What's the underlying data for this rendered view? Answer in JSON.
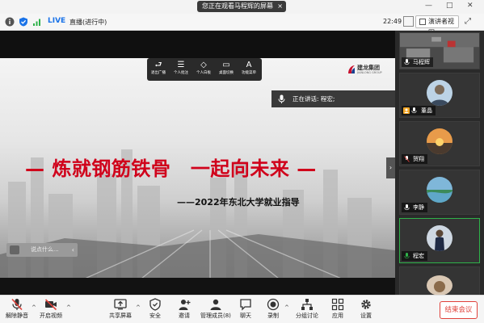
{
  "title_bar": {
    "sharing_notice": "您正在观看马程辉的屏幕",
    "close_glyph": "×",
    "minimize_glyph": "—",
    "maximize_glyph": "□",
    "close_window_glyph": "✕"
  },
  "info_bar": {
    "live_label": "LIVE",
    "live_status": "直播(进行中)",
    "clock": "22:49",
    "view_mode_label": "演讲者视图",
    "fullscreen_glyph": "⤢"
  },
  "slide": {
    "tools": [
      {
        "icon": "exit-icon",
        "glyph": "⮐",
        "label": "退出广播"
      },
      {
        "icon": "notes-icon",
        "glyph": "☰",
        "label": "个人批注"
      },
      {
        "icon": "whiteboard-icon",
        "glyph": "◇",
        "label": "个人白板"
      },
      {
        "icon": "desktop-share-icon",
        "glyph": "▭",
        "label": "桌面切换"
      },
      {
        "icon": "tools-menu-icon",
        "glyph": "A",
        "label": "功能菜单"
      }
    ],
    "brand_name": "建龙集团",
    "brand_sub": "JIANLONG GROUP",
    "speaking_label": "正在讲话: 程宏;",
    "headline": "— 炼就钢筋铁骨　一起向未来 —",
    "subline": "——2022年东北大学就业指导",
    "chat_placeholder": "说点什么...",
    "chat_toggle": "‹",
    "collapse_glyph": "›",
    "colors": {
      "headline": "#d0021b",
      "speaker_bar": "#3a3a3a"
    }
  },
  "participants": [
    {
      "name": "马程辉",
      "avatar": "video-feed",
      "active": false,
      "mic_icon": "mic-on-icon"
    },
    {
      "name": "董晶",
      "avatar": "photo",
      "active": false,
      "mic_icon": "mic-on-icon",
      "host_badge": "host-icon"
    },
    {
      "name": "贺翔",
      "avatar": "sunset-photo",
      "active": false,
      "mic_icon": "mic-muted-icon"
    },
    {
      "name": "李静",
      "avatar": "lake-photo",
      "active": false,
      "mic_icon": "mic-on-icon"
    },
    {
      "name": "程宏",
      "avatar": "person-photo",
      "active": true,
      "mic_icon": "mic-speaking-icon"
    },
    {
      "name": "",
      "avatar": "partial-photo",
      "active": false,
      "mic_icon": ""
    }
  ],
  "toolbar": {
    "items": [
      {
        "id": "unmute",
        "label": "解除静音",
        "icon": "mic-muted-icon"
      },
      {
        "id": "video",
        "label": "开启视频",
        "icon": "camera-off-icon"
      },
      {
        "id": "share",
        "label": "共享屏幕",
        "icon": "share-screen-icon"
      },
      {
        "id": "security",
        "label": "安全",
        "icon": "shield-icon"
      },
      {
        "id": "invite",
        "label": "邀请",
        "icon": "invite-icon"
      },
      {
        "id": "participants",
        "label": "管理成员(8)",
        "icon": "members-icon"
      },
      {
        "id": "chat",
        "label": "聊天",
        "icon": "chat-icon"
      },
      {
        "id": "record",
        "label": "录制",
        "icon": "record-icon"
      },
      {
        "id": "breakout",
        "label": "分组讨论",
        "icon": "breakout-icon"
      },
      {
        "id": "apps",
        "label": "应用",
        "icon": "apps-icon"
      },
      {
        "id": "settings",
        "label": "设置",
        "icon": "gear-icon"
      }
    ],
    "caret_glyph": "^",
    "end_label": "结束会议",
    "colors": {
      "end": "#e0413a",
      "muted": "#e0413a"
    }
  }
}
